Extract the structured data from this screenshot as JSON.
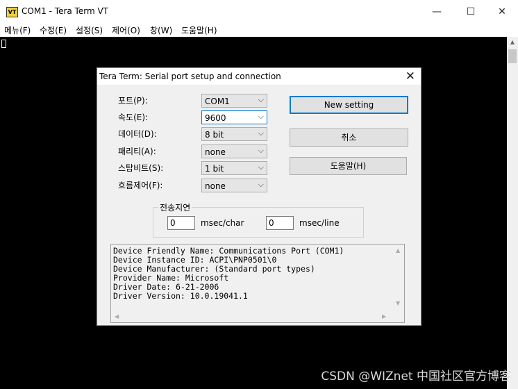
{
  "window": {
    "icon_text": "VT",
    "title": "COM1 - Tera Term VT",
    "minimize": "—",
    "maximize": "☐",
    "close": "✕"
  },
  "menu": [
    "메뉴(F)",
    "수정(E)",
    "설정(S)",
    "제어(O)",
    "창(W)",
    "도움말(H)"
  ],
  "dialog": {
    "title": "Tera Term: Serial port setup and connection",
    "close": "✕",
    "fields": [
      {
        "label": "포트(P):",
        "value": "COM1"
      },
      {
        "label": "속도(E):",
        "value": "9600"
      },
      {
        "label": "데이터(D):",
        "value": "8 bit"
      },
      {
        "label": "패리티(A):",
        "value": "none"
      },
      {
        "label": "스탑비트(S):",
        "value": "1 bit"
      },
      {
        "label": "흐름제어(F):",
        "value": "none"
      }
    ],
    "buttons": {
      "new_setting": "New setting",
      "cancel": "취소",
      "help": "도움말(H)"
    },
    "delay": {
      "label": "전송지연",
      "char_value": "0",
      "char_unit": "msec/char",
      "line_value": "0",
      "line_unit": "msec/line"
    },
    "info": [
      "Device Friendly Name: Communications Port (COM1)",
      "Device Instance ID: ACPI\\PNP0501\\0",
      "Device Manufacturer: (Standard port types)",
      "Provider Name: Microsoft",
      "Driver Date: 6-21-2006",
      "Driver Version: 10.0.19041.1"
    ]
  },
  "watermark": "CSDN @WIZnet 中国社区官方博客"
}
